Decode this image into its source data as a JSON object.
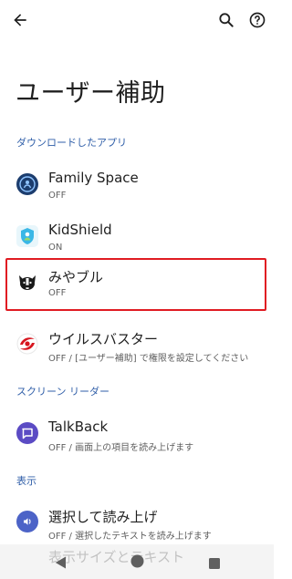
{
  "header": {
    "title": "ユーザー補助"
  },
  "sections": {
    "downloaded": "ダウンロードしたアプリ",
    "screen_reader": "スクリーン リーダー",
    "display": "表示"
  },
  "items": [
    {
      "title": "Family Space",
      "subtitle": "OFF"
    },
    {
      "title": "KidShield",
      "subtitle": "ON"
    },
    {
      "title": "みやブル",
      "subtitle": "OFF"
    },
    {
      "title": "ウイルスバスター",
      "subtitle": "OFF / [ユーザー補助] で権限を設定してください"
    },
    {
      "title": "TalkBack",
      "subtitle": "OFF / 画面上の項目を読み上げます"
    },
    {
      "title": "選択して読み上げ",
      "subtitle": "OFF / 選択したテキストを読み上げます"
    },
    {
      "title": "表示サイズとテキスト",
      "subtitle": ""
    }
  ],
  "colors": {
    "section": "#2f5ea8",
    "highlight": "#e01b22",
    "talkback": "#5b4bc4",
    "select_to_speak": "#4c63c7"
  },
  "icons": {
    "back": "arrow-back-icon",
    "search": "search-icon",
    "help": "help-circle-icon"
  }
}
